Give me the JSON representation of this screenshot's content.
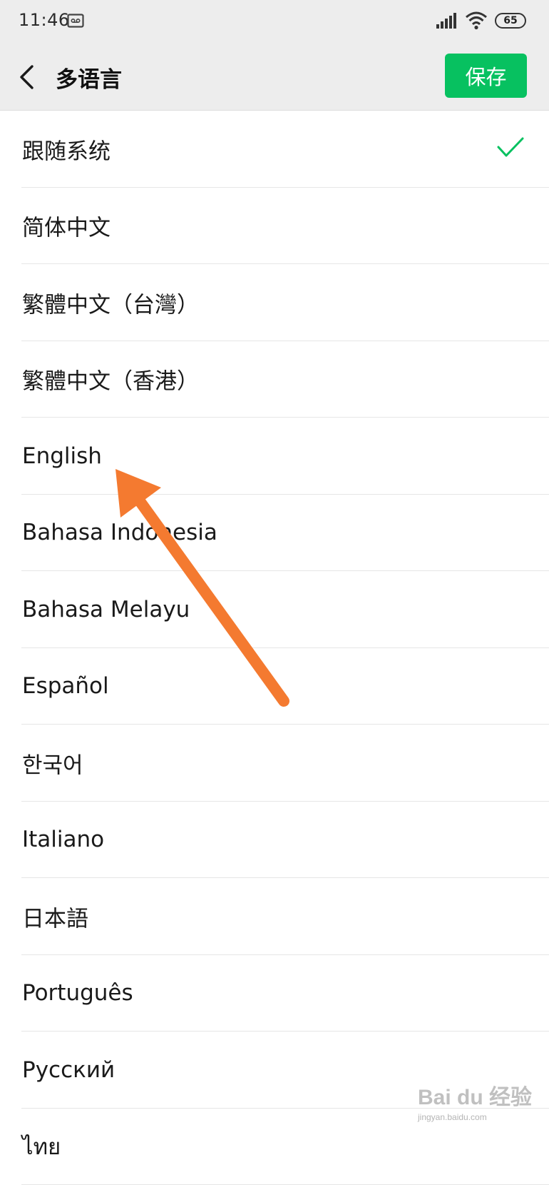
{
  "status_bar": {
    "time": "11:46",
    "battery_level": "65",
    "icons": [
      "voicemail-icon",
      "signal-icon",
      "wifi-icon",
      "battery-icon"
    ]
  },
  "nav": {
    "back_icon": "chevron-left-icon",
    "title": "多语言",
    "save_label": "保存"
  },
  "colors": {
    "accent": "#07c160",
    "annotation_arrow": "#f47a30",
    "bar_background": "#ededed"
  },
  "languages": [
    {
      "label": "跟随系统",
      "selected": true
    },
    {
      "label": "简体中文",
      "selected": false
    },
    {
      "label": "繁體中文（台灣）",
      "selected": false
    },
    {
      "label": "繁體中文（香港）",
      "selected": false
    },
    {
      "label": "English",
      "selected": false
    },
    {
      "label": "Bahasa Indonesia",
      "selected": false
    },
    {
      "label": "Bahasa Melayu",
      "selected": false
    },
    {
      "label": "Español",
      "selected": false
    },
    {
      "label": "한국어",
      "selected": false
    },
    {
      "label": "Italiano",
      "selected": false
    },
    {
      "label": "日本語",
      "selected": false
    },
    {
      "label": "Português",
      "selected": false
    },
    {
      "label": "Русский",
      "selected": false
    },
    {
      "label": "ไทย",
      "selected": false
    }
  ],
  "watermark": {
    "brand": "Bai du 经验",
    "url": "jingyan.baidu.com"
  }
}
